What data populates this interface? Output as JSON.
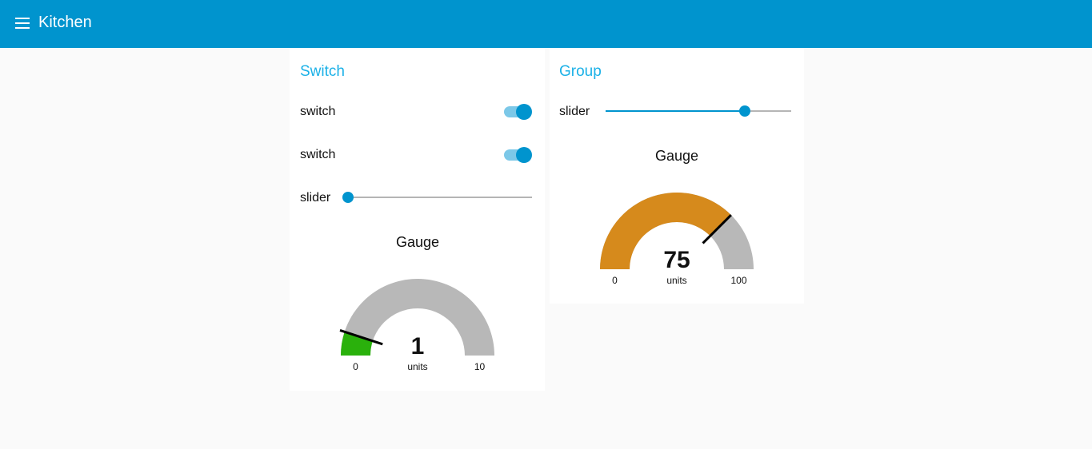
{
  "header": {
    "title": "Kitchen",
    "menu_icon": "hamburger-menu-icon",
    "color": "#0094ce"
  },
  "groups": [
    {
      "title": "Switch",
      "switches": [
        {
          "label": "switch",
          "on": true
        },
        {
          "label": "switch",
          "on": true
        }
      ],
      "slider": {
        "label": "slider",
        "value_fraction": 0.0
      },
      "gauge": {
        "title": "Gauge",
        "value": 1,
        "value_text": "1",
        "units": "units",
        "min": 0,
        "max": 10,
        "min_text": "0",
        "max_text": "10",
        "color": "#2ab10c"
      }
    },
    {
      "title": "Group",
      "slider": {
        "label": "slider",
        "value_fraction": 0.75
      },
      "gauge": {
        "title": "Gauge",
        "value": 75,
        "value_text": "75",
        "units": "units",
        "min": 0,
        "max": 100,
        "min_text": "0",
        "max_text": "100",
        "color": "#d68a1c"
      }
    }
  ],
  "colors": {
    "accent": "#0094ce",
    "group_title": "#1bb1e7",
    "gauge_background": "#b8b8b8",
    "page_background": "#fafafa"
  }
}
